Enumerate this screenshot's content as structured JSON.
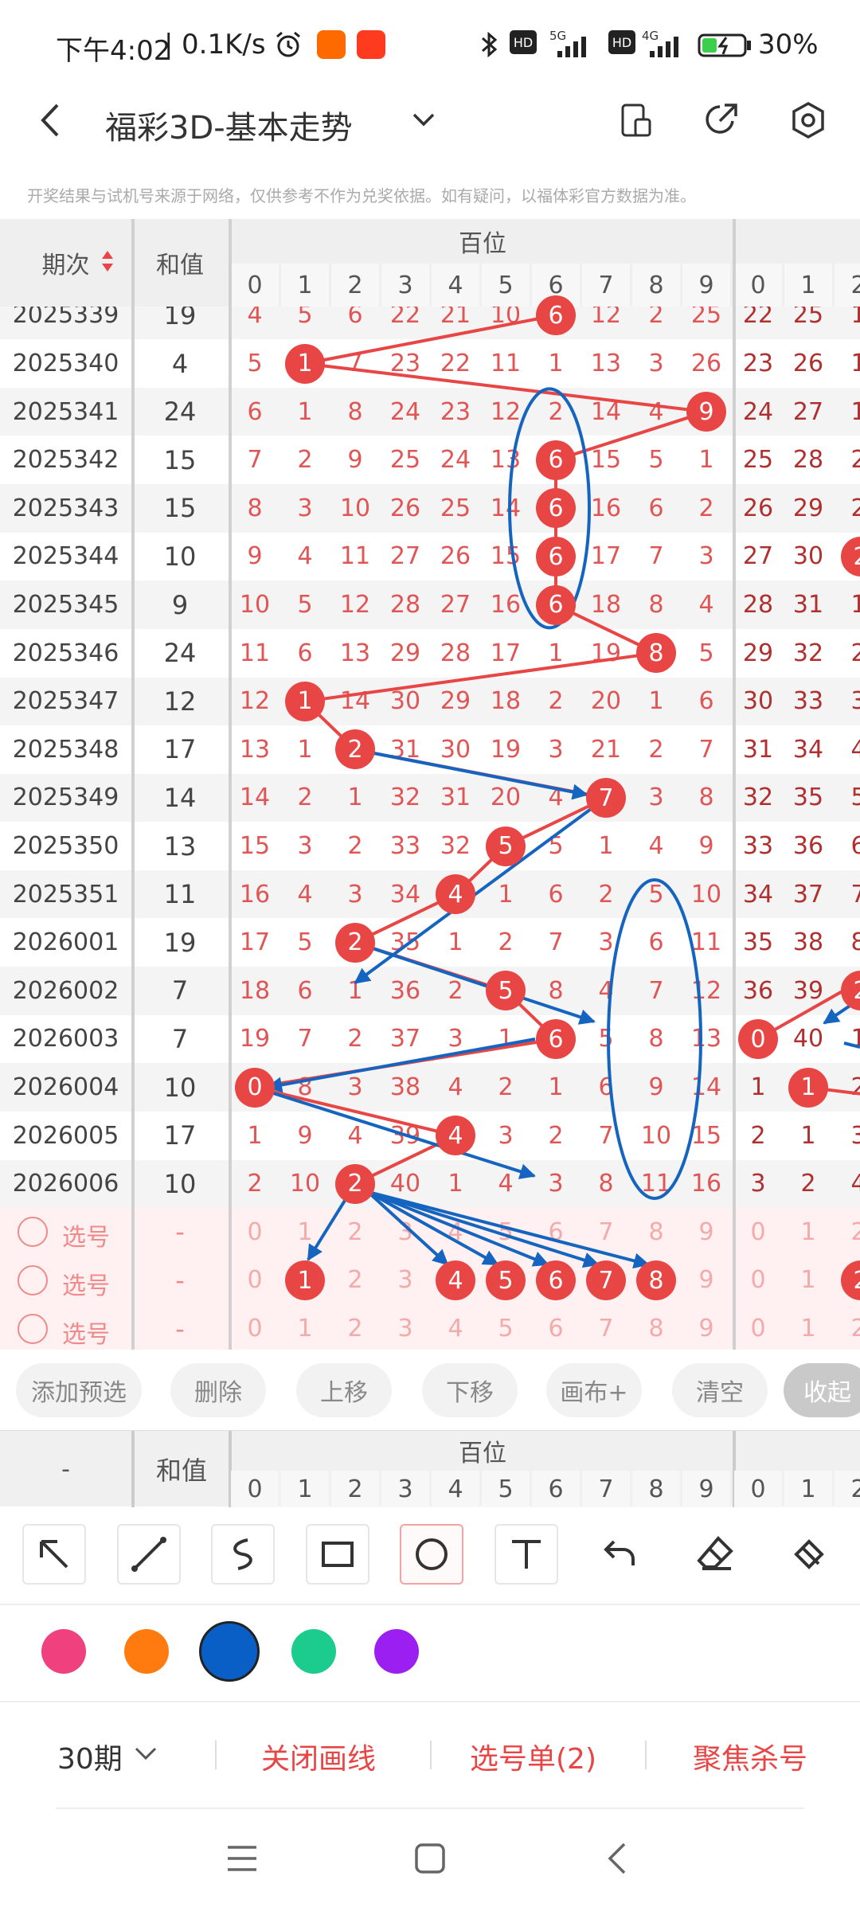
{
  "status_bar": {
    "time": "下午4:02",
    "speed": "0.1K/s",
    "network_1": "5G",
    "network_2": "4G",
    "hd_badge": "HD",
    "battery": "30%",
    "icons": [
      "alarm-icon",
      "mi-app-icon",
      "taobao-app-icon",
      "bluetooth-icon",
      "signal-icon",
      "battery-icon"
    ]
  },
  "header": {
    "title": "福彩3D-基本走势",
    "disclaimer": "开奖结果与试机号来源于网络，仅供参考不作为兑奖依据。如有疑问，以福体彩官方数据为准。",
    "icons": [
      "back-icon",
      "dropdown-chevron-icon",
      "device-icon",
      "share-icon",
      "settings-icon"
    ]
  },
  "table": {
    "col_issue": "期次",
    "col_sum": "和值",
    "group_hundreds": "百位",
    "digits": [
      "0",
      "1",
      "2",
      "3",
      "4",
      "5",
      "6",
      "7",
      "8",
      "9"
    ],
    "next_digits": [
      "0",
      "1",
      "2"
    ],
    "rows": [
      {
        "issue": "2025339",
        "sum": "19",
        "cells": [
          "4",
          "5",
          "6",
          "22",
          "21",
          "10",
          "6",
          "12",
          "2",
          "25"
        ],
        "hit": 6,
        "next": [
          "22",
          "25",
          "1"
        ]
      },
      {
        "issue": "2025340",
        "sum": "4",
        "cells": [
          "5",
          "1",
          "7",
          "23",
          "22",
          "11",
          "1",
          "13",
          "3",
          "26"
        ],
        "hit": 1,
        "next": [
          "23",
          "26",
          "1"
        ]
      },
      {
        "issue": "2025341",
        "sum": "24",
        "cells": [
          "6",
          "1",
          "8",
          "24",
          "23",
          "12",
          "2",
          "14",
          "4",
          "9"
        ],
        "hit": 9,
        "next": [
          "24",
          "27",
          "1"
        ]
      },
      {
        "issue": "2025342",
        "sum": "15",
        "cells": [
          "7",
          "2",
          "9",
          "25",
          "24",
          "13",
          "6",
          "15",
          "5",
          "1"
        ],
        "hit": 6,
        "next": [
          "25",
          "28",
          "2"
        ]
      },
      {
        "issue": "2025343",
        "sum": "15",
        "cells": [
          "8",
          "3",
          "10",
          "26",
          "25",
          "14",
          "6",
          "16",
          "6",
          "2"
        ],
        "hit": 6,
        "next": [
          "26",
          "29",
          "2"
        ]
      },
      {
        "issue": "2025344",
        "sum": "10",
        "cells": [
          "9",
          "4",
          "11",
          "27",
          "26",
          "15",
          "6",
          "17",
          "7",
          "3"
        ],
        "hit": 6,
        "next": [
          "27",
          "30",
          "2"
        ]
      },
      {
        "issue": "2025345",
        "sum": "9",
        "cells": [
          "10",
          "5",
          "12",
          "28",
          "27",
          "16",
          "6",
          "18",
          "8",
          "4"
        ],
        "hit": 6,
        "next": [
          "28",
          "31",
          "1"
        ]
      },
      {
        "issue": "2025346",
        "sum": "24",
        "cells": [
          "11",
          "6",
          "13",
          "29",
          "28",
          "17",
          "1",
          "19",
          "8",
          "5"
        ],
        "hit": 8,
        "next": [
          "29",
          "32",
          "2"
        ]
      },
      {
        "issue": "2025347",
        "sum": "12",
        "cells": [
          "12",
          "1",
          "14",
          "30",
          "29",
          "18",
          "2",
          "20",
          "1",
          "6"
        ],
        "hit": 1,
        "next": [
          "30",
          "33",
          "3"
        ]
      },
      {
        "issue": "2025348",
        "sum": "17",
        "cells": [
          "13",
          "1",
          "2",
          "31",
          "30",
          "19",
          "3",
          "21",
          "2",
          "7"
        ],
        "hit": 2,
        "next": [
          "31",
          "34",
          "4"
        ]
      },
      {
        "issue": "2025349",
        "sum": "14",
        "cells": [
          "14",
          "2",
          "1",
          "32",
          "31",
          "20",
          "4",
          "7",
          "3",
          "8"
        ],
        "hit": 7,
        "next": [
          "32",
          "35",
          "5"
        ]
      },
      {
        "issue": "2025350",
        "sum": "13",
        "cells": [
          "15",
          "3",
          "2",
          "33",
          "32",
          "5",
          "5",
          "1",
          "4",
          "9"
        ],
        "hit": 5,
        "next": [
          "33",
          "36",
          "6"
        ]
      },
      {
        "issue": "2025351",
        "sum": "11",
        "cells": [
          "16",
          "4",
          "3",
          "34",
          "4",
          "1",
          "6",
          "2",
          "5",
          "10"
        ],
        "hit": 4,
        "next": [
          "34",
          "37",
          "7"
        ]
      },
      {
        "issue": "2026001",
        "sum": "19",
        "cells": [
          "17",
          "5",
          "2",
          "35",
          "1",
          "2",
          "7",
          "3",
          "6",
          "11"
        ],
        "hit": 2,
        "next": [
          "35",
          "38",
          "8"
        ]
      },
      {
        "issue": "2026002",
        "sum": "7",
        "cells": [
          "18",
          "6",
          "1",
          "36",
          "2",
          "5",
          "8",
          "4",
          "7",
          "12"
        ],
        "hit": 5,
        "next": [
          "36",
          "39",
          "2"
        ]
      },
      {
        "issue": "2026003",
        "sum": "7",
        "cells": [
          "19",
          "7",
          "2",
          "37",
          "3",
          "1",
          "6",
          "5",
          "8",
          "13"
        ],
        "hit": 6,
        "next": [
          "0",
          "40",
          "1"
        ]
      },
      {
        "issue": "2026004",
        "sum": "10",
        "cells": [
          "0",
          "8",
          "3",
          "38",
          "4",
          "2",
          "1",
          "6",
          "9",
          "14"
        ],
        "hit": 0,
        "next": [
          "1",
          "1",
          "2"
        ]
      },
      {
        "issue": "2026005",
        "sum": "17",
        "cells": [
          "1",
          "9",
          "4",
          "39",
          "4",
          "3",
          "2",
          "7",
          "10",
          "15"
        ],
        "hit": 4,
        "next": [
          "2",
          "1",
          "3"
        ]
      },
      {
        "issue": "2026006",
        "sum": "10",
        "cells": [
          "2",
          "10",
          "2",
          "40",
          "1",
          "4",
          "3",
          "8",
          "11",
          "16"
        ],
        "hit": 2,
        "next": [
          "3",
          "2",
          "4"
        ]
      }
    ],
    "pick_rows": [
      {
        "label": "选号",
        "sum": "-",
        "cells": [
          "0",
          "1",
          "2",
          "3",
          "4",
          "5",
          "6",
          "7",
          "8",
          "9"
        ],
        "balls": [],
        "next": [
          "0",
          "1",
          "2"
        ]
      },
      {
        "label": "选号",
        "sum": "-",
        "cells": [
          "0",
          "1",
          "2",
          "3",
          "4",
          "5",
          "6",
          "7",
          "8",
          "9"
        ],
        "balls": [
          1,
          4,
          5,
          6,
          7,
          8
        ],
        "next": [
          "0",
          "1",
          "2"
        ]
      },
      {
        "label": "选号",
        "sum": "-",
        "cells": [
          "0",
          "1",
          "2",
          "3",
          "4",
          "5",
          "6",
          "7",
          "8",
          "9"
        ],
        "balls": [],
        "next": [
          "0",
          "1",
          "2"
        ]
      }
    ]
  },
  "actions": {
    "add_preselect": "添加预选",
    "delete": "删除",
    "move_up": "上移",
    "move_down": "下移",
    "canvas_plus": "画布+",
    "clear": "清空",
    "collapse": "收起"
  },
  "footer_header": {
    "dash": "-",
    "sum": "和值",
    "group_hundreds": "百位"
  },
  "draw_tools": [
    "arrow-tool-icon",
    "line-tool-icon",
    "freehand-tool-icon",
    "rectangle-tool-icon",
    "ellipse-tool-icon",
    "text-tool-icon",
    "undo-icon",
    "eraser-icon",
    "clear-all-icon"
  ],
  "selected_tool": "ellipse-tool-icon",
  "colors": [
    "#f0417f",
    "#ff7b0f",
    "#0a5fc6",
    "#1bcc8e",
    "#9b1ff0"
  ],
  "selected_color": "#0a5fc6",
  "bottom_bar": {
    "periods": "30期",
    "close_lines": "关闭画线",
    "pick_list": "选号单(2)",
    "focus_kill": "聚焦杀号"
  },
  "nav_icons": [
    "menu-icon",
    "home-icon",
    "back-nav-icon"
  ]
}
